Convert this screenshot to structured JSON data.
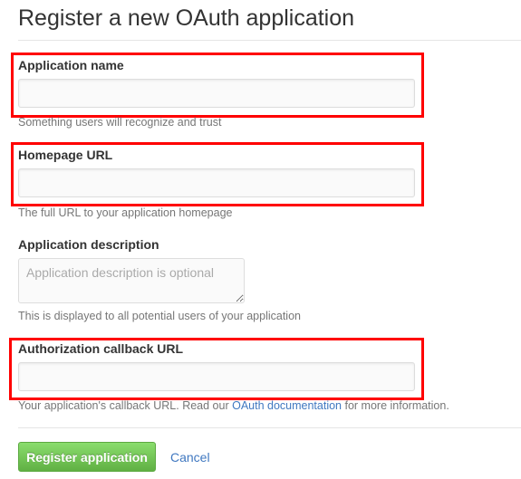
{
  "page_title": "Register a new OAuth application",
  "fields": [
    {
      "label": "Application name",
      "value": "",
      "note": "Something users will recognize and trust"
    },
    {
      "label": "Homepage URL",
      "value": "",
      "note": "The full URL to your application homepage"
    },
    {
      "label": "Application description",
      "placeholder": "Application description is optional",
      "note": "This is displayed to all potential users of your application"
    },
    {
      "label": "Authorization callback URL",
      "value": "",
      "note_pre": "Your application's callback URL. Read our ",
      "note_link": "OAuth documentation",
      "note_post": " for more information."
    }
  ],
  "actions": {
    "register_label": "Register application",
    "cancel_label": "Cancel"
  },
  "colors": {
    "highlight": "#ff0000",
    "primary": "#60b044",
    "link": "#4078c0"
  }
}
